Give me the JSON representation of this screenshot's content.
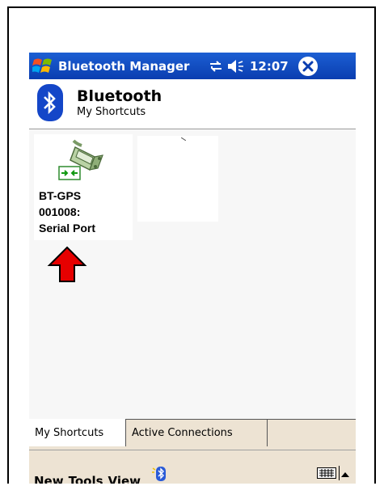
{
  "titlebar": {
    "title": "Bluetooth Manager",
    "clock": "12:07",
    "accent": "#0a3db0"
  },
  "header": {
    "title": "Bluetooth",
    "subtitle": "My Shortcuts"
  },
  "shortcuts": [
    {
      "line1": "BT-GPS",
      "line2": "001008:",
      "line3": "Serial Port"
    }
  ],
  "annotation": {
    "arrow_color": "#e60000"
  },
  "tabs": [
    {
      "label": "My Shortcuts",
      "active": true
    },
    {
      "label": "Active Connections",
      "active": false
    }
  ],
  "menubar": {
    "items": [
      "New",
      "Tools",
      "View"
    ]
  }
}
